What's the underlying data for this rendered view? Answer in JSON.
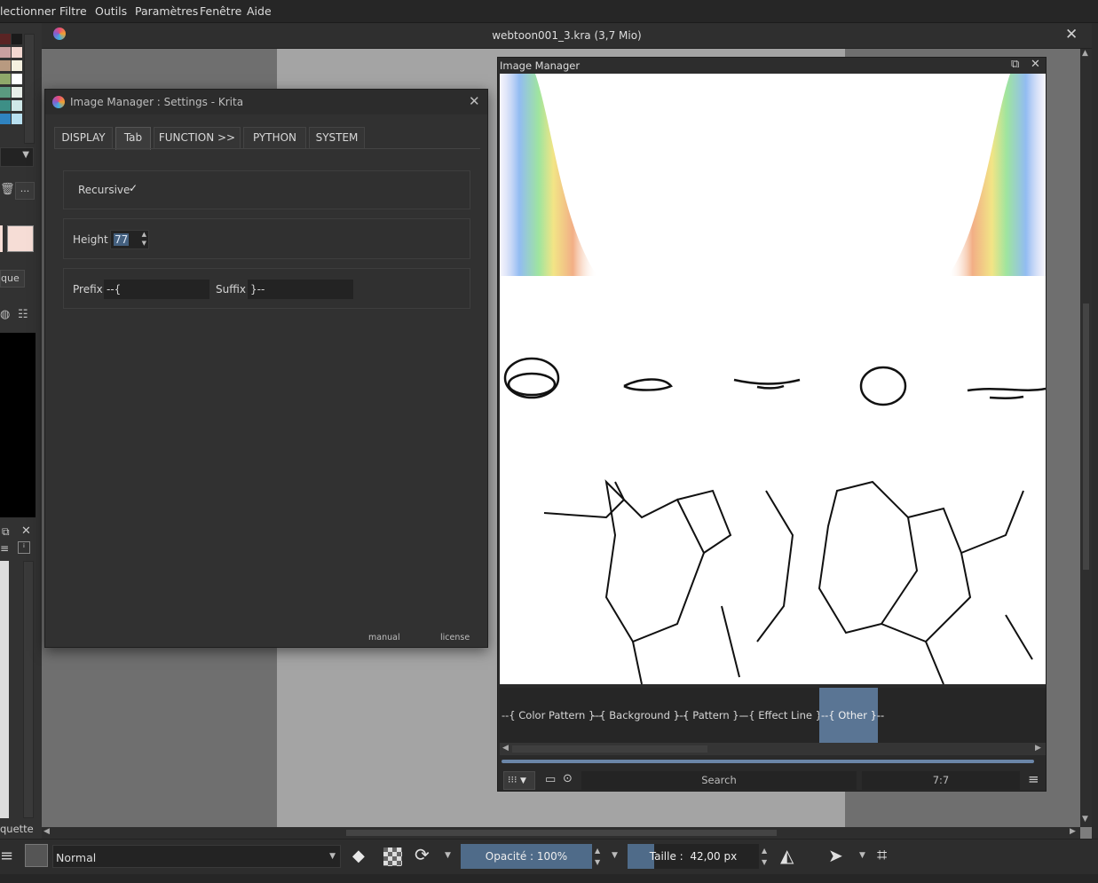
{
  "menu": {
    "items": [
      "lectionner",
      "Filtre",
      "Outils",
      "Paramètres",
      "Fenêtre",
      "Aide"
    ]
  },
  "document": {
    "title": "webtoon001_3.kra (3,7 Mio)"
  },
  "left_dock": {
    "label_tab": "que",
    "label_bottom": "quette",
    "more_button": "...",
    "swatches": [
      "#5a2424",
      "#1a1a1a",
      "#c9a0a0",
      "#f2d7d0",
      "#b89a80",
      "#f4f0e0",
      "#8fa86a",
      "#ffffff",
      "#5a9a80",
      "#e8eee8",
      "#3d8f86",
      "#cfe8e8",
      "#2f83c0",
      "#b8e0f0"
    ],
    "preview_color": "#f6ddd6"
  },
  "settings_dialog": {
    "title": "Image Manager : Settings - Krita",
    "tabs": [
      "DISPLAY",
      "Tab",
      "FUNCTION >>",
      "PYTHON",
      "SYSTEM"
    ],
    "active_tab": "Tab",
    "recursive_label": "Recursive",
    "recursive_checked": true,
    "height_label": "Height",
    "height_value": "77",
    "prefix_label": "Prefix",
    "prefix_value": "--{",
    "suffix_label": "Suffix",
    "suffix_value": "}--",
    "manual_link": "manual",
    "license_link": "license"
  },
  "image_manager": {
    "title": "Image Manager",
    "tabs": [
      "--{ Color Pattern }--",
      "--{ Background }--",
      "--{ Pattern }--",
      "--{ Effect Line }--",
      "--{ Other }--"
    ],
    "active_tab": "--{ Other }--",
    "search_placeholder": "Search",
    "counter": "7:7"
  },
  "toolbar": {
    "blend_mode": "Normal",
    "opacity_label": "Opacité : 100%",
    "opacity_value": 1.0,
    "size_label": "Taille :  42,00 px",
    "size_fill": 0.2
  },
  "colors": {
    "accent": "#5a7594",
    "slider_fill": "#4f6b89"
  }
}
